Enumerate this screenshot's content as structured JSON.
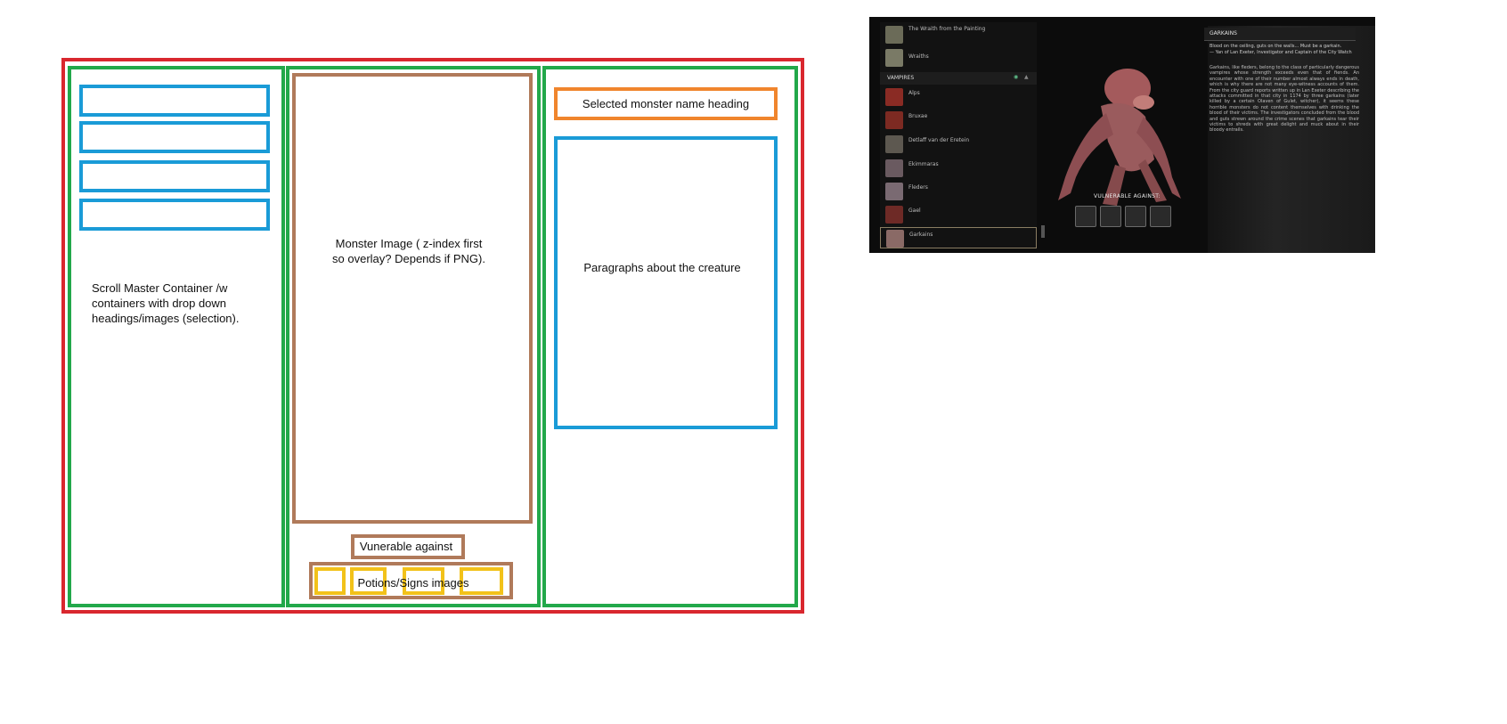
{
  "wireframe": {
    "scroll_container_label": "Scroll Master Container /w containers with drop down headings/images (selection).",
    "monster_image_label": "Monster Image ( z-index first so overlay? Depends if PNG).",
    "vulnerable_label": "Vunerable against",
    "potions_label": "Potions/Signs images",
    "heading_label": "Selected monster name heading",
    "paragraphs_label": "Paragraphs about the creature",
    "colors": {
      "outer": "#d9272e",
      "column": "#22a84a",
      "list_item": "#1a9bd7",
      "image": "#b07a5a",
      "heading": "#f0852d",
      "icon": "#f2c21a"
    }
  },
  "reference": {
    "list_items": [
      {
        "name": "The Wraith from the Painting",
        "thumb_color": "#6b6b58"
      },
      {
        "name": "Wraiths",
        "thumb_color": "#7a7a66"
      }
    ],
    "section_heading": "VAMPIRES",
    "vampires": [
      {
        "name": "Alps",
        "thumb_color": "#8a2b24"
      },
      {
        "name": "Bruxae",
        "thumb_color": "#7d2a22"
      },
      {
        "name": "Detlaff van der Eretein",
        "thumb_color": "#5d5850"
      },
      {
        "name": "Ekimmaras",
        "thumb_color": "#6a5a60"
      },
      {
        "name": "Fleders",
        "thumb_color": "#7a6a72"
      },
      {
        "name": "Gael",
        "thumb_color": "#6e2a26"
      },
      {
        "name": "Garkains",
        "thumb_color": "#8a6a66",
        "selected": true
      }
    ],
    "title": "GARKAINS",
    "quote": "Blood on the ceiling, guts on the walls... Must be a garkain.",
    "quote_source": "— Yan of Lan Exeter, Investigator and Captain of the City Watch",
    "paragraph": "Garkains, like fleders, belong to the class of particularly dangerous vampires whose strength exceeds even that of fiends. An encounter with one of their number almost always ends in death, which is why there are not many eye-witness accounts of them. From the city guard reports written up in Lan Exeter describing the attacks committed in that city in 1174 by three garkains (later killed by a certain Olaven of Gulet, witcher), it seems these horrible monsters do not content themselves with drinking the blood of their victims. The investigators concluded from the blood and guts strewn around the crime scenes that garkains tear their victims to shreds with great delight and muck about in their bloody entrails.",
    "vulnerable_heading": "VULNERABLE AGAINST:",
    "vulnerable_icons": [
      "oil-icon",
      "bomb-icon",
      "potion-icon",
      "decoction-icon"
    ]
  }
}
